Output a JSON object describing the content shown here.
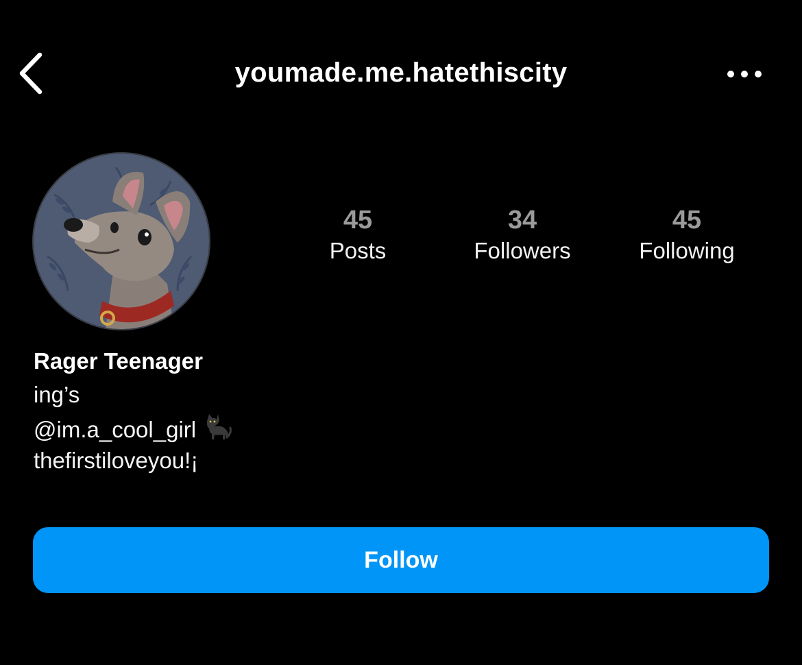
{
  "header": {
    "username": "youmade.me.hatethiscity",
    "back_icon": "chevron-left-icon",
    "more_icon": "ellipsis-icon"
  },
  "profile": {
    "avatar_description_icon": "avatar-image",
    "stats": [
      {
        "value": "45",
        "label": "Posts"
      },
      {
        "value": "34",
        "label": "Followers"
      },
      {
        "value": "45",
        "label": "Following"
      }
    ],
    "display_name": "Rager Teenager",
    "bio_lines": [
      "ing’s",
      "@im.a_cool_girl",
      "thefirstiloveyou!¡"
    ],
    "bio_emoji_icon": "black-cat-icon"
  },
  "actions": {
    "follow_label": "Follow"
  },
  "colors": {
    "background": "#000000",
    "follow_button": "#0095f6",
    "stat_number": "#9a9a9a"
  }
}
